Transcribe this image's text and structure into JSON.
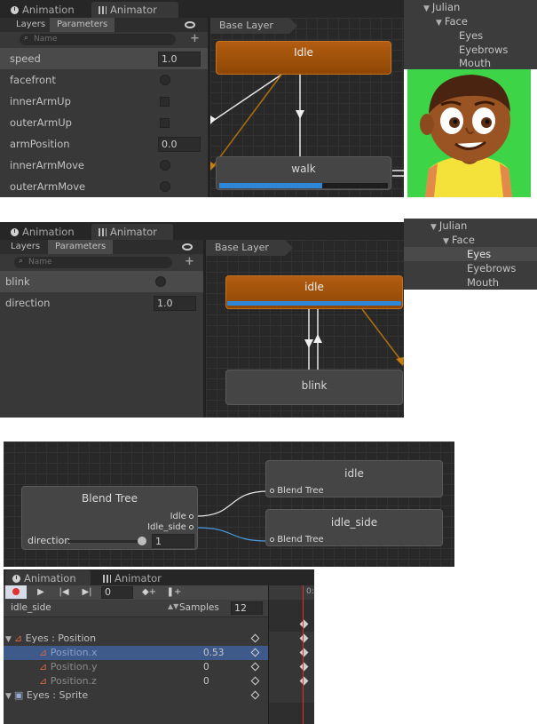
{
  "panel1": {
    "tabs": [
      {
        "label": "Animation"
      },
      {
        "label": "Animator"
      }
    ],
    "layers_label": "Layers",
    "parameters_label": "Parameters",
    "search_placeholder": "Name",
    "base_layer": "Base Layer",
    "params": [
      {
        "name": "speed",
        "type": "float",
        "value": "1.0"
      },
      {
        "name": "facefront",
        "type": "bool"
      },
      {
        "name": "innerArmUp",
        "type": "trigger"
      },
      {
        "name": "outerArmUp",
        "type": "trigger"
      },
      {
        "name": "armPosition",
        "type": "float",
        "value": "0.0"
      },
      {
        "name": "innerArmMove",
        "type": "bool"
      },
      {
        "name": "outerArmMove",
        "type": "bool"
      }
    ],
    "states": {
      "idle": "Idle",
      "walk": "walk"
    },
    "walk_progress": 0.61
  },
  "hierarchy1": {
    "root": "Julian",
    "face": "Face",
    "children": [
      "Eyes",
      "Eyebrows",
      "Mouth"
    ]
  },
  "panel2": {
    "tabs": [
      {
        "label": "Animation"
      },
      {
        "label": "Animator"
      }
    ],
    "layers_label": "Layers",
    "parameters_label": "Parameters",
    "search_placeholder": "Name",
    "base_layer": "Base Layer",
    "params": [
      {
        "name": "blink",
        "type": "bool"
      },
      {
        "name": "direction",
        "type": "float",
        "value": "1.0"
      }
    ],
    "states": {
      "idle": "idle",
      "blink": "blink"
    },
    "idle_progress": 1.0
  },
  "hierarchy2": {
    "root": "Julian",
    "face": "Face",
    "children": [
      "Eyes",
      "Eyebrows",
      "Mouth"
    ],
    "selected": "Eyes"
  },
  "blendtree": {
    "title": "Blend Tree",
    "outputs": [
      "Idle",
      "Idle_side"
    ],
    "param_name": "direction",
    "param_value": "1",
    "slider_value": 1.0,
    "targets": [
      {
        "name": "idle",
        "input": "Blend Tree"
      },
      {
        "name": "idle_side",
        "input": "Blend Tree"
      }
    ]
  },
  "animation": {
    "tabs": [
      {
        "label": "Animation"
      },
      {
        "label": "Animator"
      }
    ],
    "frame": "0",
    "clip": "idle_side",
    "samples_label": "Samples",
    "samples": "12",
    "ruler_label": "0:",
    "tracks": [
      {
        "label": "Eyes : Position",
        "value": "",
        "level": 0
      },
      {
        "label": "Position.x",
        "value": "0.53",
        "level": 1,
        "selected": true
      },
      {
        "label": "Position.y",
        "value": "0",
        "level": 1
      },
      {
        "label": "Position.z",
        "value": "0",
        "level": 1
      },
      {
        "label": "Eyes : Sprite",
        "value": "",
        "level": 0
      }
    ]
  },
  "colors": {
    "accent_blue": "#2e86d6",
    "state_orange": "#a4530b",
    "record_red": "#e03030"
  }
}
